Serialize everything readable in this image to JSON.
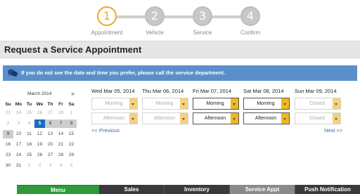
{
  "stepper": {
    "steps": [
      {
        "number": "1",
        "label": "Appointment",
        "active": true
      },
      {
        "number": "2",
        "label": "Vehicle",
        "active": false
      },
      {
        "number": "3",
        "label": "Service",
        "active": false
      },
      {
        "number": "4",
        "label": "Confirm",
        "active": false
      }
    ]
  },
  "page": {
    "title": "Request a Service Appointment",
    "info_message": "If you do not see the date and time you prefer, please call the service department."
  },
  "calendar": {
    "month_label": "March 2014",
    "next_symbol": "»",
    "weekdays": [
      "Su",
      "Mo",
      "Tu",
      "We",
      "Th",
      "Fr",
      "Sa"
    ],
    "weeks": [
      [
        "23",
        "24",
        "25",
        "26",
        "27",
        "28",
        "1"
      ],
      [
        "2",
        "3",
        "4",
        "5",
        "6",
        "7",
        "8"
      ],
      [
        "9",
        "10",
        "11",
        "12",
        "13",
        "14",
        "15"
      ],
      [
        "16",
        "17",
        "18",
        "19",
        "20",
        "21",
        "22"
      ],
      [
        "23",
        "24",
        "25",
        "26",
        "27",
        "28",
        "29"
      ],
      [
        "30",
        "31",
        "1",
        "2",
        "3",
        "4",
        "5"
      ]
    ],
    "selected_day": "5"
  },
  "days": [
    {
      "name": "Wed Mar 05, 2014",
      "morning": "Morning",
      "afternoon": "Afternoon",
      "enabled": false
    },
    {
      "name": "Thu Mar 06, 2014",
      "morning": "Morning",
      "afternoon": "Afternoon",
      "enabled": false
    },
    {
      "name": "Fri Mar 07, 2014",
      "morning": "Morning",
      "afternoon": "Afternoon",
      "enabled": true
    },
    {
      "name": "Sat Mar 08, 2014",
      "morning": "Morning",
      "afternoon": "Afternoon",
      "enabled": true
    },
    {
      "name": "Sun Mar 09, 2014",
      "morning": "Closed",
      "afternoon": "Closed",
      "enabled": false
    }
  ],
  "pager": {
    "prev_label": "<< Previous",
    "next_label": "Next >>"
  },
  "bottom_nav": {
    "menu": "Menu",
    "sales": "Sales",
    "inventory": "Inventory",
    "service_appt": "Service Appt",
    "push_notification": "Push Notification"
  },
  "colors": {
    "active_step": "#f5a623",
    "info_banner": "#5b8fc9",
    "selected_date": "#1b6bc2",
    "menu_green": "#2e9b3a",
    "dropdown_arrow": "#f0b821"
  }
}
